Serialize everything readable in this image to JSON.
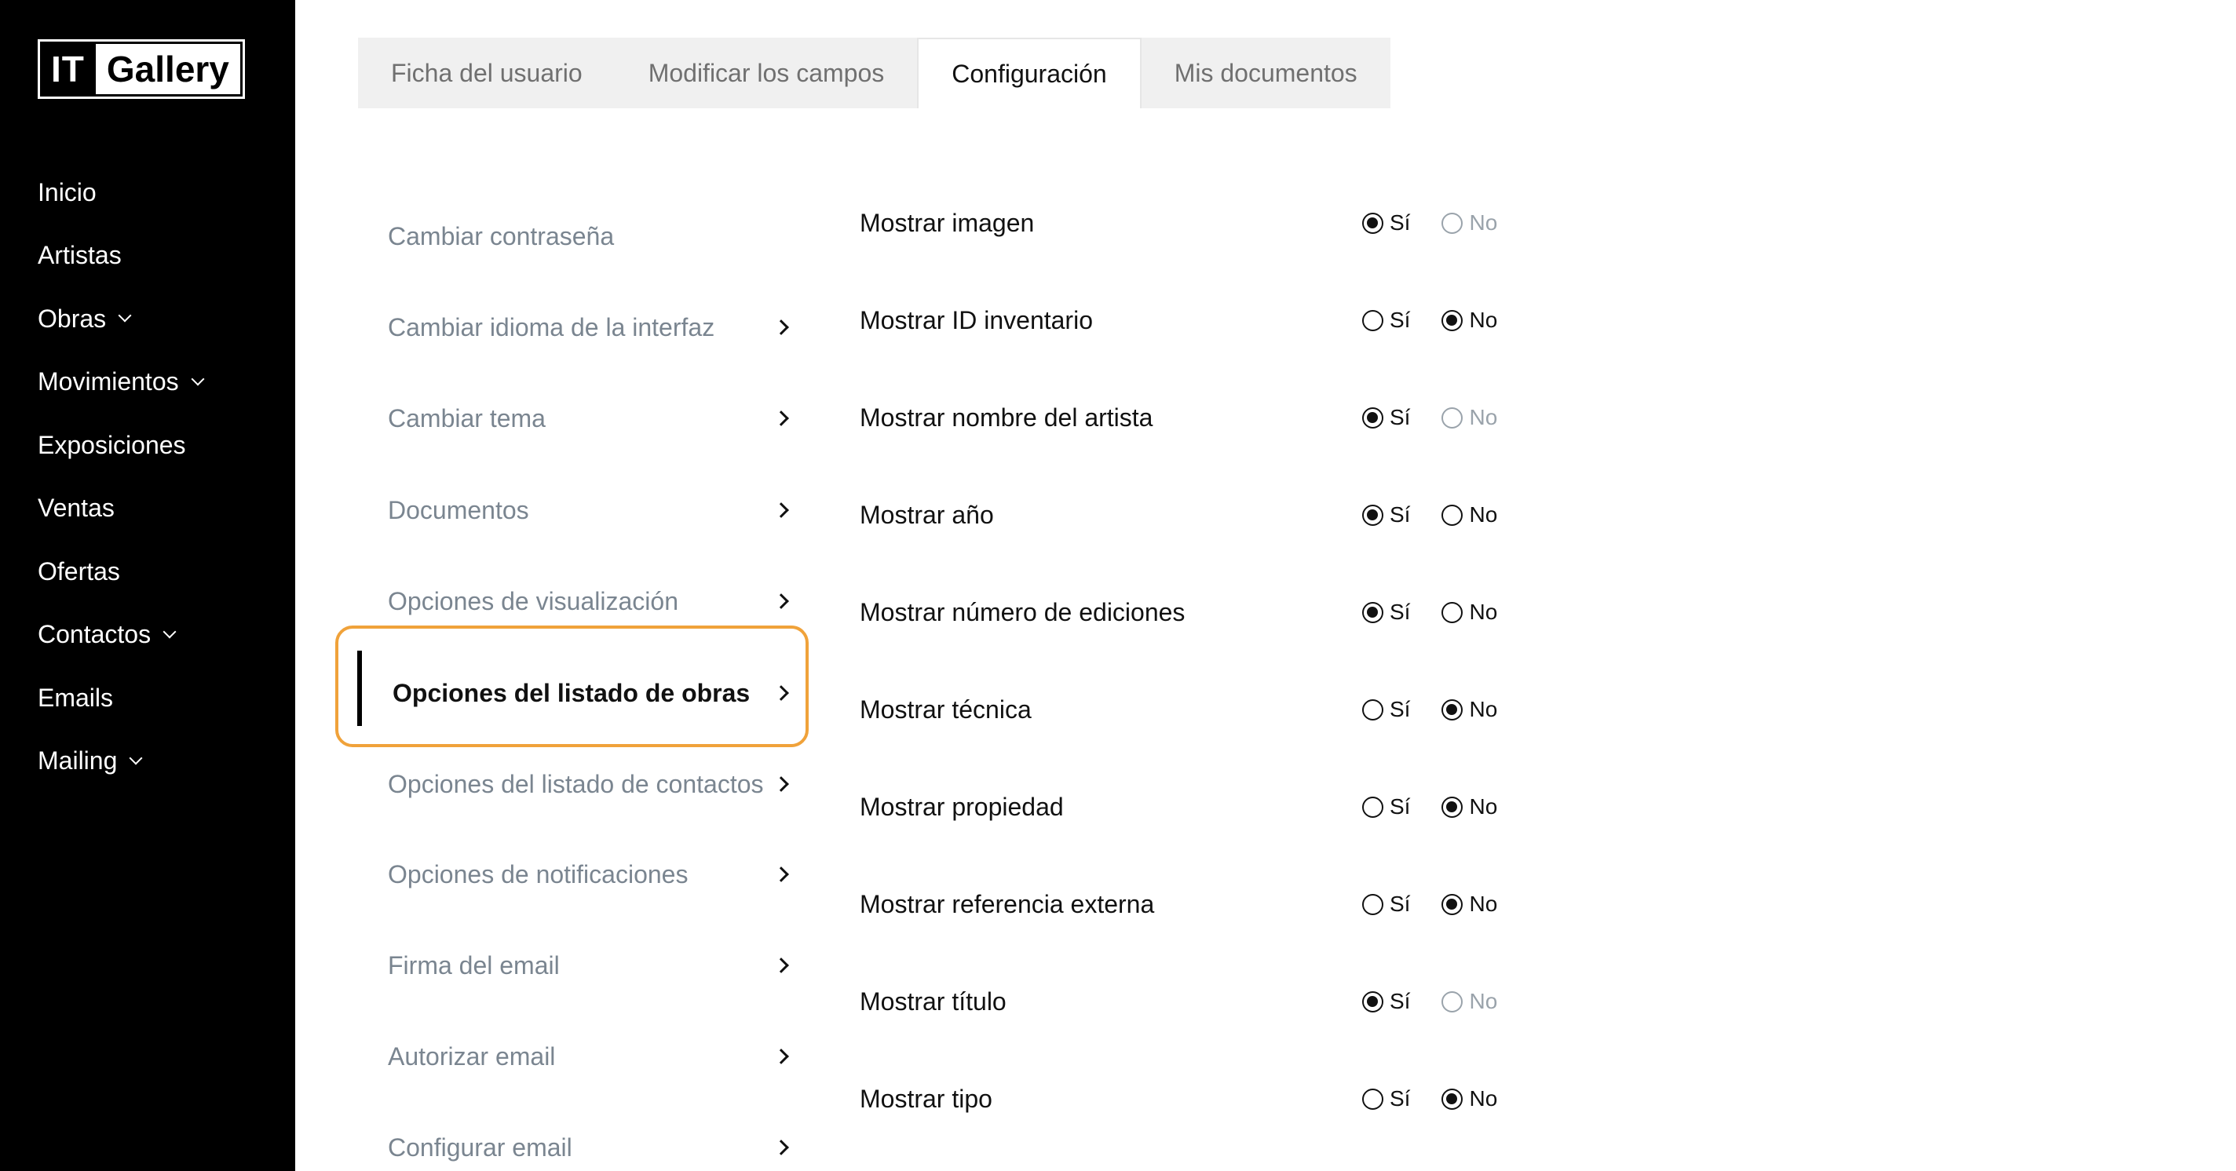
{
  "brand": {
    "left": "IT",
    "right": "Gallery"
  },
  "nav": [
    {
      "label": "Inicio",
      "dropdown": false
    },
    {
      "label": "Artistas",
      "dropdown": false
    },
    {
      "label": "Obras",
      "dropdown": true
    },
    {
      "label": "Movimientos",
      "dropdown": true
    },
    {
      "label": "Exposiciones",
      "dropdown": false
    },
    {
      "label": "Ventas",
      "dropdown": false
    },
    {
      "label": "Ofertas",
      "dropdown": false
    },
    {
      "label": "Contactos",
      "dropdown": true
    },
    {
      "label": "Emails",
      "dropdown": false
    },
    {
      "label": "Mailing",
      "dropdown": true
    }
  ],
  "tabs": [
    {
      "label": "Ficha del usuario",
      "active": false
    },
    {
      "label": "Modificar los campos",
      "active": false
    },
    {
      "label": "Configuración",
      "active": true
    },
    {
      "label": "Mis documentos",
      "active": false
    }
  ],
  "menu": [
    {
      "label": "Cambiar contraseña",
      "arrow": false,
      "active": false
    },
    {
      "label": "Cambiar idioma de la interfaz",
      "arrow": true,
      "active": false
    },
    {
      "label": "Cambiar tema",
      "arrow": true,
      "active": false
    },
    {
      "label": "Documentos",
      "arrow": true,
      "active": false
    },
    {
      "label": "Opciones de visualización",
      "arrow": true,
      "active": false
    },
    {
      "label": "Opciones del listado de obras",
      "arrow": true,
      "active": true
    },
    {
      "label": "Opciones del listado de contactos",
      "arrow": true,
      "active": false
    },
    {
      "label": "Opciones de notificaciones",
      "arrow": true,
      "active": false
    },
    {
      "label": "Firma del email",
      "arrow": true,
      "active": false
    },
    {
      "label": "Autorizar email",
      "arrow": true,
      "active": false
    },
    {
      "label": "Configurar email",
      "arrow": true,
      "active": false
    }
  ],
  "radio_labels": {
    "yes": "Sí",
    "no": "No"
  },
  "options": [
    {
      "label": "Mostrar imagen",
      "value": "yes",
      "no_muted": true
    },
    {
      "label": "Mostrar ID inventario",
      "value": "no",
      "no_muted": false
    },
    {
      "label": "Mostrar nombre del artista",
      "value": "yes",
      "no_muted": true
    },
    {
      "label": "Mostrar año",
      "value": "yes",
      "no_muted": false
    },
    {
      "label": "Mostrar número de ediciones",
      "value": "yes",
      "no_muted": false
    },
    {
      "label": "Mostrar técnica",
      "value": "no",
      "no_muted": false
    },
    {
      "label": "Mostrar propiedad",
      "value": "no",
      "no_muted": false
    },
    {
      "label": "Mostrar referencia externa",
      "value": "no",
      "no_muted": false
    },
    {
      "label": "Mostrar título",
      "value": "yes",
      "no_muted": true
    },
    {
      "label": "Mostrar tipo",
      "value": "no",
      "no_muted": false
    }
  ],
  "colors": {
    "sidebar_bg": "#000000",
    "highlight": "#f0a23a",
    "muted_text": "#7a8590"
  }
}
